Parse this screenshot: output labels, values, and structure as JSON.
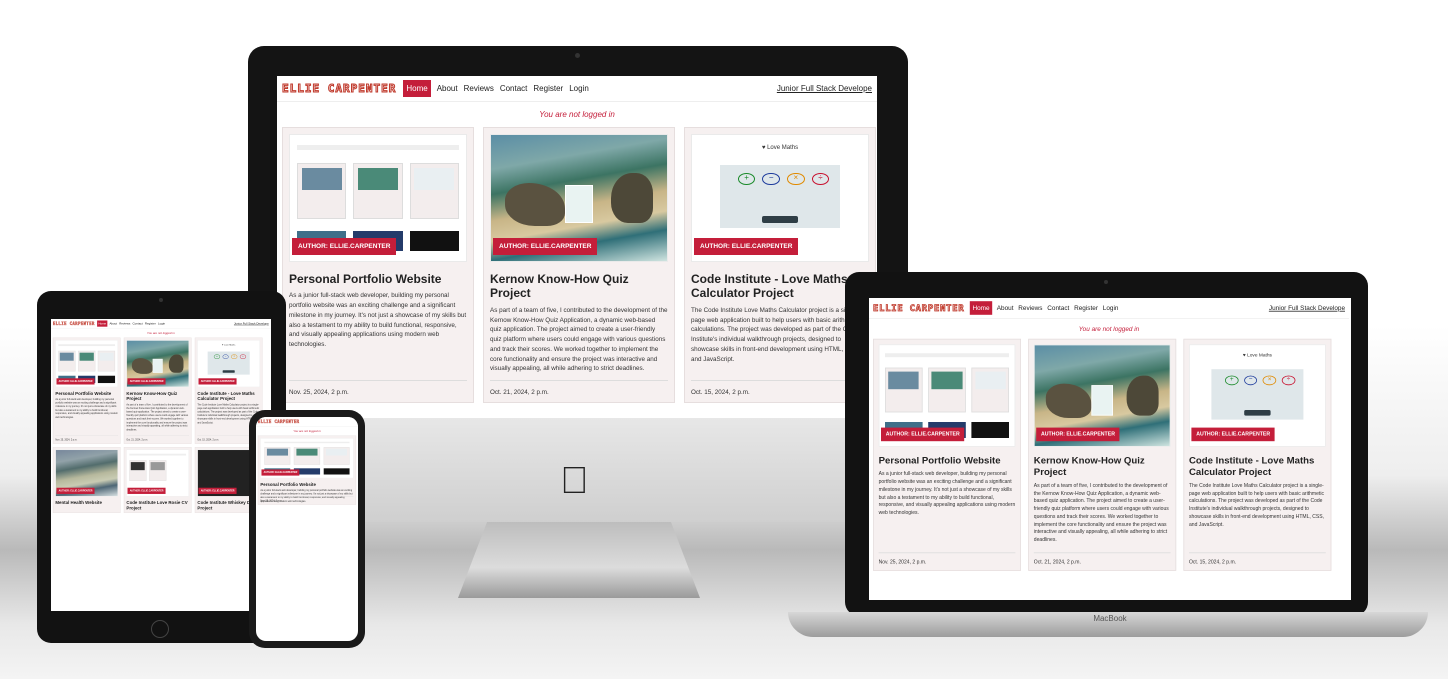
{
  "site": {
    "logo": "ELLIE CARPENTER",
    "nav": [
      "Home",
      "About",
      "Reviews",
      "Contact",
      "Register",
      "Login"
    ],
    "tagline": "Junior Full Stack Develope",
    "notice": "You are not logged in",
    "badge": "AUTHOR: ELLIE.CARPENTER",
    "maths_thumb_title": "Love Maths",
    "cards": [
      {
        "title": "Personal Portfolio Website",
        "text": "As a junior full-stack web developer, building my personal portfolio website was an exciting challenge and a significant milestone in my journey. It's not just a showcase of my skills but also a testament to my ability to build functional, responsive, and visually appealing applications using modern web technologies.",
        "date": "Nov. 25, 2024, 2 p.m."
      },
      {
        "title": "Kernow Know-How Quiz Project",
        "text": "As part of a team of five, I contributed to the development of the Kernow Know-How Quiz Application, a dynamic web-based quiz application. The project aimed to create a user-friendly quiz platform where users could engage with various questions and track their scores. We worked together to implement the core functionality and ensure the project was interactive and visually appealing, all while adhering to strict deadlines.",
        "date": "Oct. 21, 2024, 2 p.m."
      },
      {
        "title": "Code Institute - Love Maths Calculator Project",
        "text": "The Code Institute Love Maths Calculator project is a single-page web application built to help users with basic arithmetic calculations. The project was developed as part of the Code Institute's individual walkthrough projects, designed to showcase skills in front-end development using HTML, CSS, and JavaScript.",
        "date": "Oct. 15, 2024, 2 p.m."
      }
    ],
    "more_cards": [
      "Mental Health Website",
      "Code Institute Love Rosie CV Project",
      "Code Institute Whiskey Drop Project"
    ]
  },
  "devices": {
    "laptop_label": "MacBook"
  },
  "colors": {
    "accent": "#c41e3a",
    "card_bg": "#f6f0f0"
  }
}
